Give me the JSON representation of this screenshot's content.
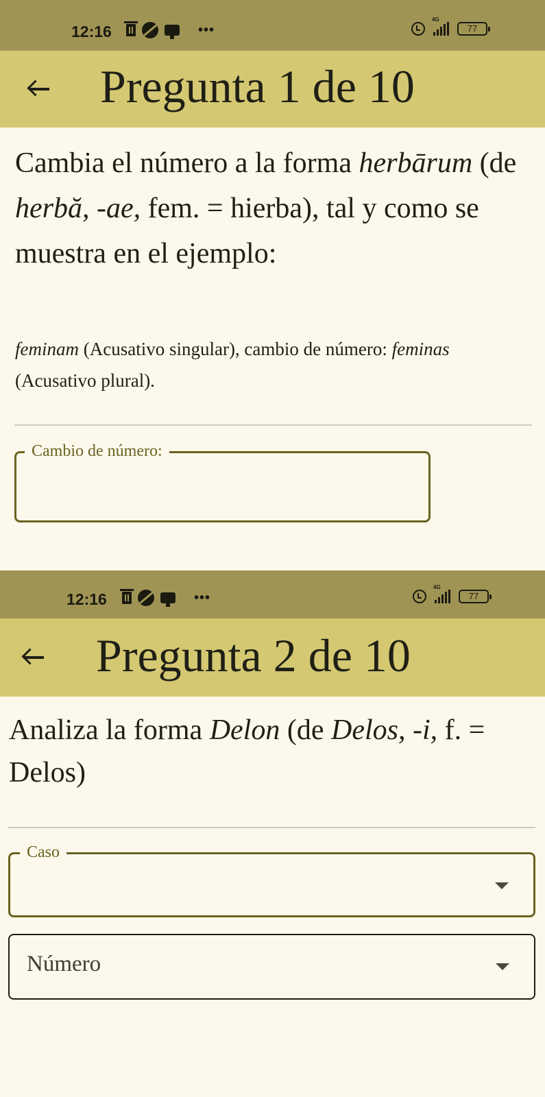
{
  "screens": [
    {
      "status": {
        "time": "12:16",
        "network": "4G",
        "battery": "77",
        "more": "•••"
      },
      "app_bar": {
        "title": "Pregunta 1 de 10"
      },
      "question": {
        "p1": "Cambia el número a la forma ",
        "form": "herbārum",
        "p2": " (de ",
        "lemma": "herbă, -ae,",
        "p3": " fem. = hierba), tal y como se muestra en el ejemplo:"
      },
      "example": {
        "w1": "feminam",
        "t1": " (Acusativo singular), cambio de número: ",
        "w2": "feminas",
        "t2": " (Acusativo plural)."
      },
      "answer_field": {
        "label": "Cambio de número:",
        "value": ""
      }
    },
    {
      "status": {
        "time": "12:16",
        "network": "4G",
        "battery": "77",
        "more": "•••"
      },
      "app_bar": {
        "title": "Pregunta 2 de 10"
      },
      "question": {
        "p1": "Analiza la forma ",
        "form": "Delon",
        "p2": " (de ",
        "lemma": "Delos, -i,",
        "p3": " f. = Delos)"
      },
      "case_select": {
        "label": "Caso",
        "value": ""
      },
      "number_select": {
        "placeholder": "Número"
      }
    }
  ],
  "colors": {
    "background": "#fdf8ec",
    "status_bar": "#a09455",
    "app_bar": "#d4c872",
    "accent": "#6a6321"
  }
}
